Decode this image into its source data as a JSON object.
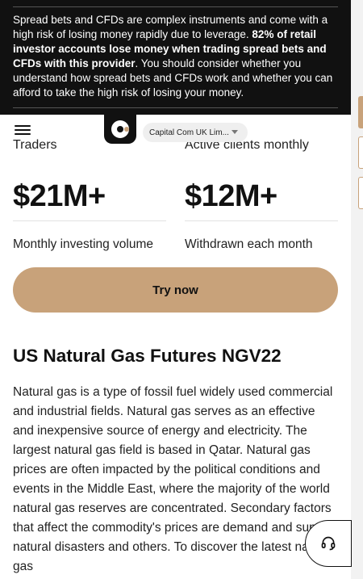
{
  "risk_banner": {
    "text_before": "Spread bets and CFDs are complex instruments and come with a high risk of losing money rapidly due to leverage. ",
    "text_bold": "82% of retail investor accounts lose money when trading spread bets and CFDs with this provider",
    "text_after": ". You should consider whether you understand how spread bets and CFDs work and whether you can afford to take the high risk of losing your money."
  },
  "header": {
    "entity_selected": "Capital Com UK Lim..."
  },
  "stats": [
    {
      "top_label": "Traders",
      "value": "$21M+",
      "caption": "Monthly investing volume"
    },
    {
      "top_label": "Active clients monthly",
      "value": "$12M+",
      "caption": "Withdrawn each month"
    }
  ],
  "cta": {
    "label": "Try now"
  },
  "article": {
    "title": "US Natural Gas Futures NGV22",
    "body": "Natural gas is a type of fossil fuel widely used commercial and industrial fields. Natural gas serves as an effective and inexpensive source of energy and electricity. The largest natural gas field is based in Qatar. Natural gas prices are often impacted by the political conditions and events in the Middle East, where the majority of the world natural gas reserves are concentrated. Secondary factors that affect the commodity's prices are demand and supply, natural disasters and others. To discover the latest natural gas"
  },
  "colors": {
    "accent": "#c8a27a",
    "banner_bg": "#111111"
  },
  "icons": {
    "menu": "hamburger-icon",
    "support": "headset-icon",
    "dropdown": "caret-down-icon"
  }
}
